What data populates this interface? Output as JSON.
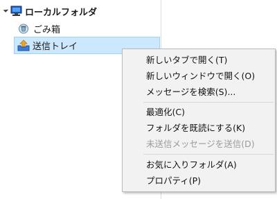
{
  "tree": {
    "account": {
      "label": "ローカルフォルダ",
      "icon": "computer-icon"
    },
    "trash": {
      "label": "ごみ箱",
      "icon": "trash-icon"
    },
    "outbox": {
      "label": "送信トレイ",
      "icon": "outbox-icon",
      "selected": true
    }
  },
  "context_menu": {
    "groups": [
      [
        {
          "label": "新しいタブで開く(T)",
          "enabled": true
        },
        {
          "label": "新しいウィンドウで開く(O)",
          "enabled": true
        },
        {
          "label": "メッセージを検索(S)...",
          "enabled": true
        }
      ],
      [
        {
          "label": "最適化(C)",
          "enabled": true
        },
        {
          "label": "フォルダを既読にする(K)",
          "enabled": true
        },
        {
          "label": "未送信メッセージを送信(D)",
          "enabled": false
        }
      ],
      [
        {
          "label": "お気に入りフォルダ(A)",
          "enabled": true
        },
        {
          "label": "プロパティ(P)",
          "enabled": true
        }
      ]
    ]
  },
  "colors": {
    "selection_bg": "#cce8ff",
    "selection_border": "#99d1ff",
    "menu_bg": "#f2f2f2",
    "disabled_text": "#9a9a9a"
  }
}
